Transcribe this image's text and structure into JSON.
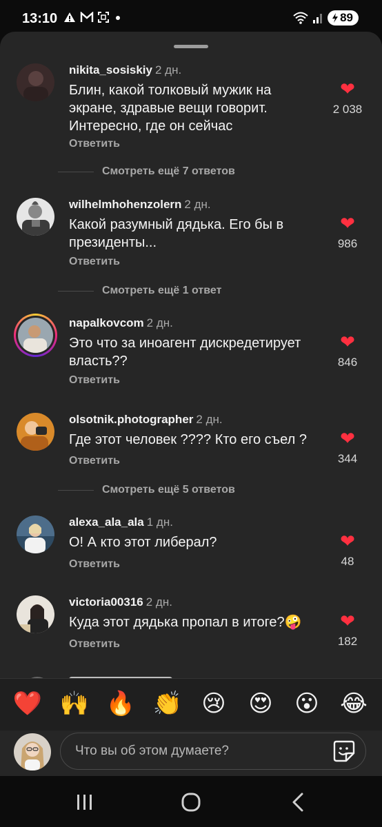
{
  "status_bar": {
    "time": "13:10",
    "battery": "89",
    "left_icons": [
      "warning-icon",
      "mail-icon",
      "screenshot-icon",
      "dot-icon"
    ],
    "right_icons": [
      "wifi-icon",
      "signal-icon",
      "battery-icon"
    ]
  },
  "comments": [
    {
      "username": "nikita_sosiskiy",
      "age": "2 дн.",
      "text_lines": [
        "Блин, какой толковый мужик на",
        "экране, здравые вещи говорит.",
        "Интересно, где он сейчас"
      ],
      "reply": "Ответить",
      "likes": "2 038",
      "more_replies": "Смотреть ещё 7 ответов"
    },
    {
      "username": "wilhelmhohenzolern",
      "age": "2 дн.",
      "text_lines": [
        "Какой разумный дядька. Его бы в",
        "президенты..."
      ],
      "reply": "Ответить",
      "likes": "986",
      "more_replies": "Смотреть ещё 1 ответ"
    },
    {
      "username": "napalkovcom",
      "age": "2 дн.",
      "text_lines": [
        "Это что за иноагент дискредетирует",
        "власть??"
      ],
      "reply": "Ответить",
      "likes": "846",
      "more_replies": ""
    },
    {
      "username": "olsotnik.photographer",
      "age": "2 дн.",
      "text_lines": [
        "Где этот человек ???? Кто его съел ?"
      ],
      "reply": "Ответить",
      "likes": "344",
      "more_replies": "Смотреть ещё 5 ответов"
    },
    {
      "username": "alexa_ala_ala",
      "age": "1 дн.",
      "text_lines": [
        "О! А кто этот либерал?"
      ],
      "reply": "Ответить",
      "likes": "48",
      "more_replies": ""
    },
    {
      "username": "victoria00316",
      "age": "2 дн.",
      "text_lines": [
        "Куда этот дядька пропал в итоге?🤪"
      ],
      "reply": "Ответить",
      "likes": "182",
      "more_replies": ""
    }
  ],
  "reactions": [
    "❤️",
    "🙌",
    "🔥",
    "👏",
    "😢",
    "😍",
    "😮",
    "😂"
  ],
  "composer": {
    "placeholder": "Что вы об этом думаете?",
    "icon": "sticker-icon"
  },
  "colors": {
    "sheet": "#262626",
    "like": "#ff3040",
    "muted": "#a8a8a8"
  },
  "nav_icons": [
    "recent-apps-icon",
    "home-icon",
    "back-icon"
  ]
}
